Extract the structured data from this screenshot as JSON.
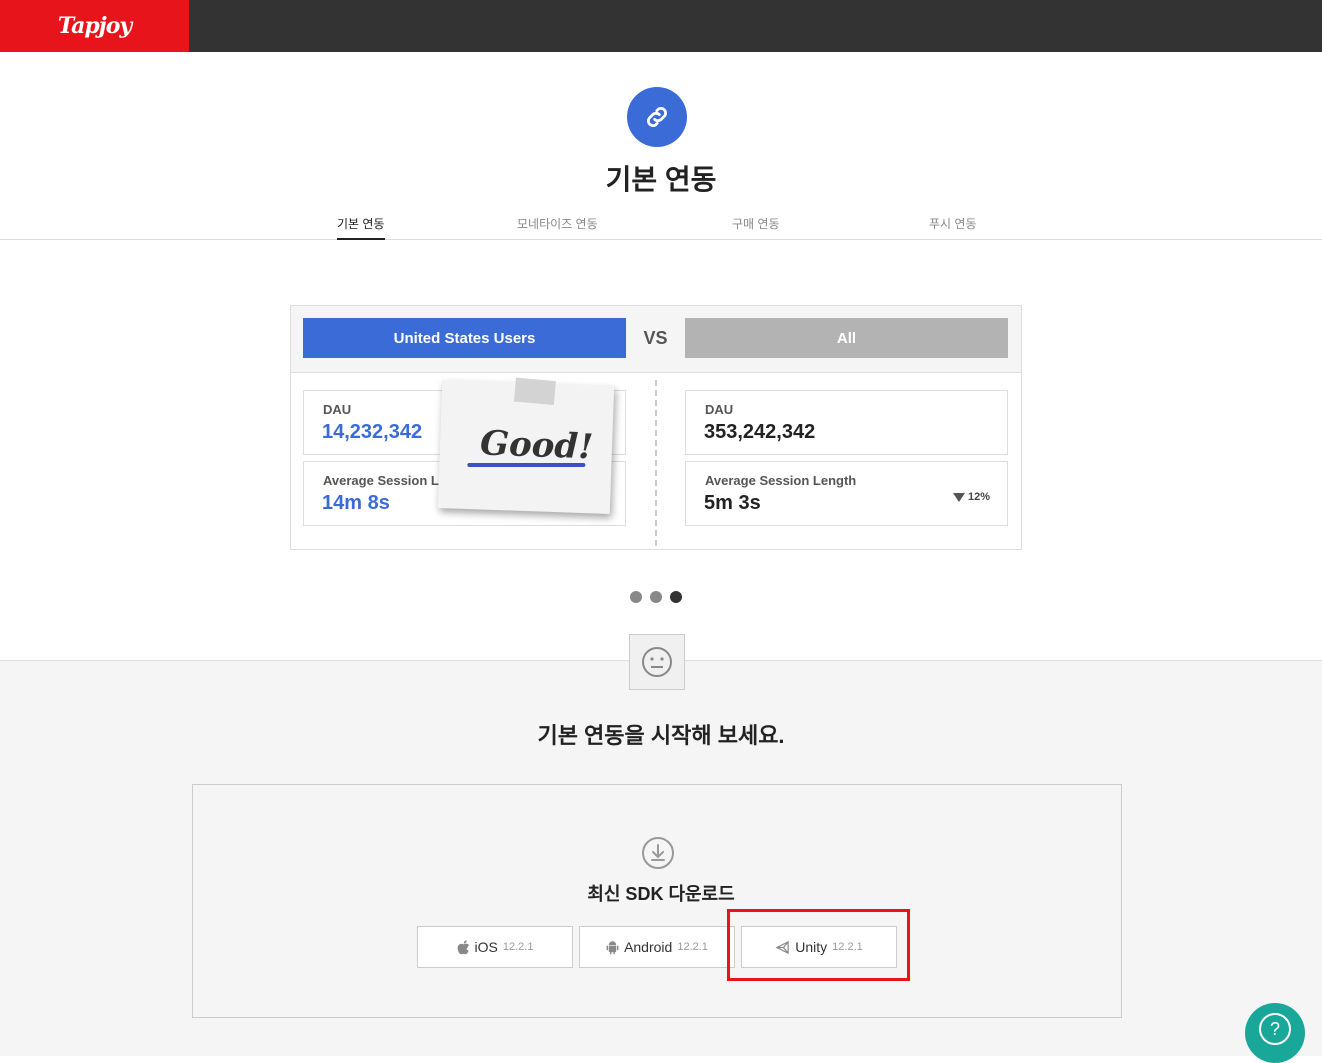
{
  "brand": {
    "logo_text": "Tapjoy",
    "accent": "#e8141c",
    "primary": "#3b6bd6",
    "help_color": "#19a79a"
  },
  "header": {
    "icon": "link-icon",
    "title": "기본 연동"
  },
  "tabs": [
    {
      "label": "기본 연동",
      "active": true
    },
    {
      "label": "모네타이즈 연동",
      "active": false
    },
    {
      "label": "구매 연동",
      "active": false
    },
    {
      "label": "푸시 연동",
      "active": false
    }
  ],
  "comparison": {
    "left_label": "United States Users",
    "vs_label": "VS",
    "right_label": "All",
    "left": {
      "dau_label": "DAU",
      "dau_value": "14,232,342",
      "session_label": "Average Session Length",
      "session_value": "14m 8s"
    },
    "right": {
      "dau_label": "DAU",
      "dau_value": "353,242,342",
      "session_label": "Average Session Length",
      "session_value": "5m 3s",
      "delta": "12%"
    },
    "note_text": "Good!"
  },
  "carousel": {
    "count": 3,
    "active_index": 2
  },
  "cta": {
    "icon": "neutral-face-icon",
    "title": "기본 연동을 시작해 보세요."
  },
  "sdk": {
    "icon": "download-icon",
    "title": "최신 SDK 다운로드",
    "buttons": [
      {
        "platform": "iOS",
        "version": "12.2.1",
        "icon": "apple-icon"
      },
      {
        "platform": "Android",
        "version": "12.2.1",
        "icon": "android-icon"
      },
      {
        "platform": "Unity",
        "version": "12.2.1",
        "icon": "unity-icon",
        "highlighted": true
      }
    ]
  },
  "help": {
    "label": "?",
    "icon": "help-icon"
  }
}
